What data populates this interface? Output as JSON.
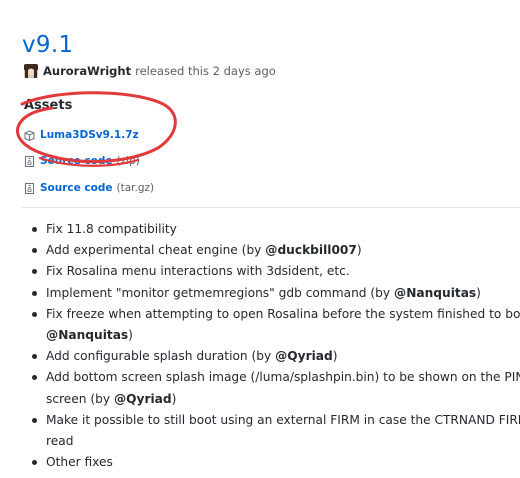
{
  "release": {
    "version": "v9.1",
    "author": "AuroraWright",
    "released_text": "released this 2 days ago"
  },
  "assets": {
    "title": "Assets",
    "items": [
      {
        "label": "Luma3DSv9.1.7z",
        "ext": "",
        "icon": "package-icon"
      },
      {
        "label": "Source code",
        "ext": "(zip)",
        "icon": "file-zip-icon"
      },
      {
        "label": "Source code",
        "ext": "(tar.gz)",
        "icon": "file-zip-icon"
      }
    ]
  },
  "notes": {
    "items": [
      {
        "text": "Fix 11.8 compatibility"
      },
      {
        "pre": "Add experimental cheat engine (by ",
        "mention": "@duckbill007",
        "post": ")"
      },
      {
        "text": "Fix Rosalina menu interactions with 3dsident, etc."
      },
      {
        "pre": "Implement \"monitor getmemregions\" gdb command (by ",
        "mention": "@Nanquitas",
        "post": ")"
      },
      {
        "line1": "Fix freeze when attempting to open Rosalina before the system finished to boot (by",
        "mention": "@Nanquitas",
        "post": ")"
      },
      {
        "pre": "Add configurable splash duration (by ",
        "mention": "@Qyriad",
        "post": ")"
      },
      {
        "line1": "Add bottom screen splash image (/luma/splashpin.bin) to be shown on the PIN inse",
        "pre": "screen (by ",
        "mention": "@Qyriad",
        "post": ")"
      },
      {
        "line1": "Make it possible to still boot using an external FIRM in case the CTRNAND FIRM can",
        "text": "read"
      },
      {
        "text": "Other fixes"
      }
    ]
  },
  "annotation": {
    "color": "#e03a3a"
  }
}
